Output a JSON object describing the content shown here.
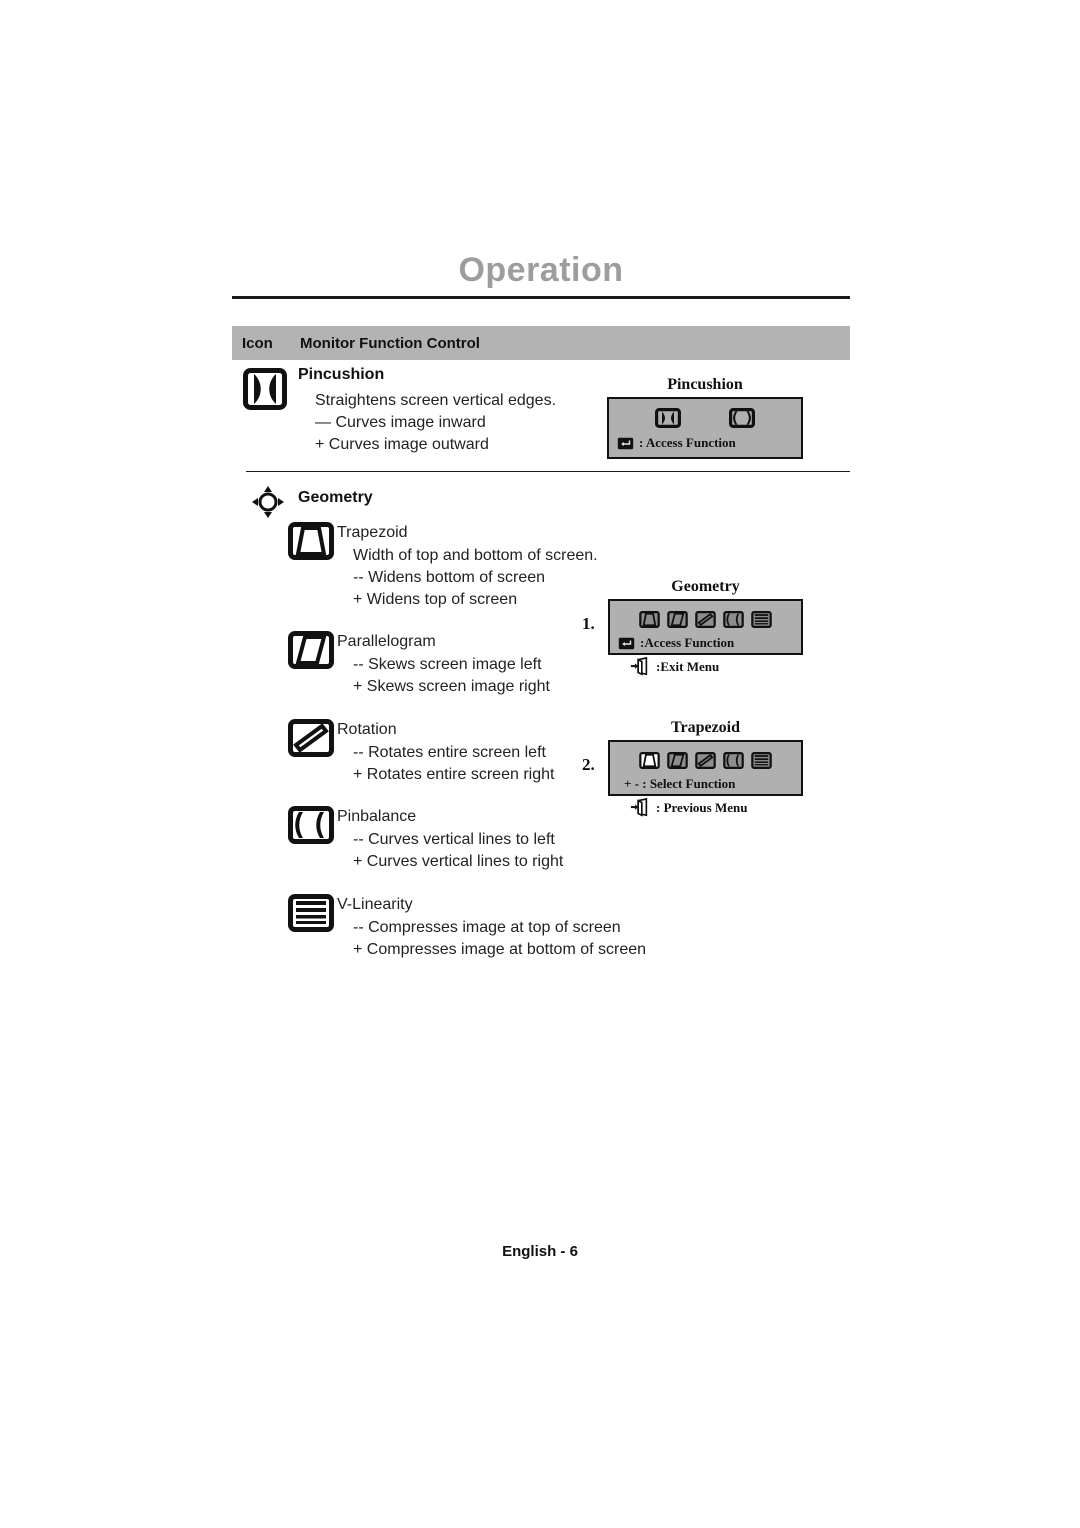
{
  "document": {
    "title": "Operation",
    "footer": "English - 6"
  },
  "table_header": {
    "icon_column": "Icon",
    "function_column": "Monitor Function Control"
  },
  "sections": [
    {
      "id": "pincushion",
      "icon": "pincushion-icon",
      "title": "Pincushion",
      "lines": [
        "Straightens screen vertical edges.",
        "— Curves image inward",
        "+ Curves image outward"
      ]
    },
    {
      "id": "geometry",
      "icon": "geometry-compass-icon",
      "title": "Geometry",
      "items": [
        {
          "id": "trapezoid",
          "icon": "trapezoid-icon",
          "name": "Trapezoid",
          "lines": [
            "Width of top and bottom of screen.",
            "-- Widens bottom of screen",
            "+ Widens top of screen"
          ]
        },
        {
          "id": "parallelogram",
          "icon": "parallelogram-icon",
          "name": "Parallelogram",
          "lines": [
            "-- Skews screen image left",
            "+ Skews screen image right"
          ]
        },
        {
          "id": "rotation",
          "icon": "rotation-icon",
          "name": "Rotation",
          "lines": [
            "-- Rotates entire screen left",
            "+ Rotates entire screen right"
          ]
        },
        {
          "id": "pinbalance",
          "icon": "pinbalance-icon",
          "name": "Pinbalance",
          "lines": [
            "-- Curves vertical lines to left",
            "+ Curves vertical lines to right"
          ]
        },
        {
          "id": "vlinearity",
          "icon": "v-linearity-icon",
          "name": "V-Linearity",
          "lines": [
            "-- Compresses image at top of screen",
            "+ Compresses image at bottom of screen"
          ]
        }
      ]
    }
  ],
  "osd_panels": [
    {
      "id": "pincushion-osd",
      "caption": "Pincushion",
      "step": "",
      "inside_label": ": Access Function",
      "inside_icon": "enter-key-icon",
      "below_label": "",
      "below_icon": ""
    },
    {
      "id": "geometry-osd",
      "caption": "Geometry",
      "step": "1.",
      "inside_label": ":Access Function",
      "inside_icon": "enter-key-icon",
      "below_label": ":Exit Menu",
      "below_icon": "exit-door-icon"
    },
    {
      "id": "trapezoid-osd",
      "caption": "Trapezoid",
      "step": "2.",
      "inside_label": "+ - : Select Function",
      "inside_icon": "",
      "below_label": ": Previous Menu",
      "below_icon": "exit-door-icon"
    }
  ],
  "colors": {
    "title_gray": "#9d9d9d",
    "header_bar_gray": "#b3b3b3",
    "osd_gray": "#b0b0b0",
    "ink": "#111111"
  }
}
